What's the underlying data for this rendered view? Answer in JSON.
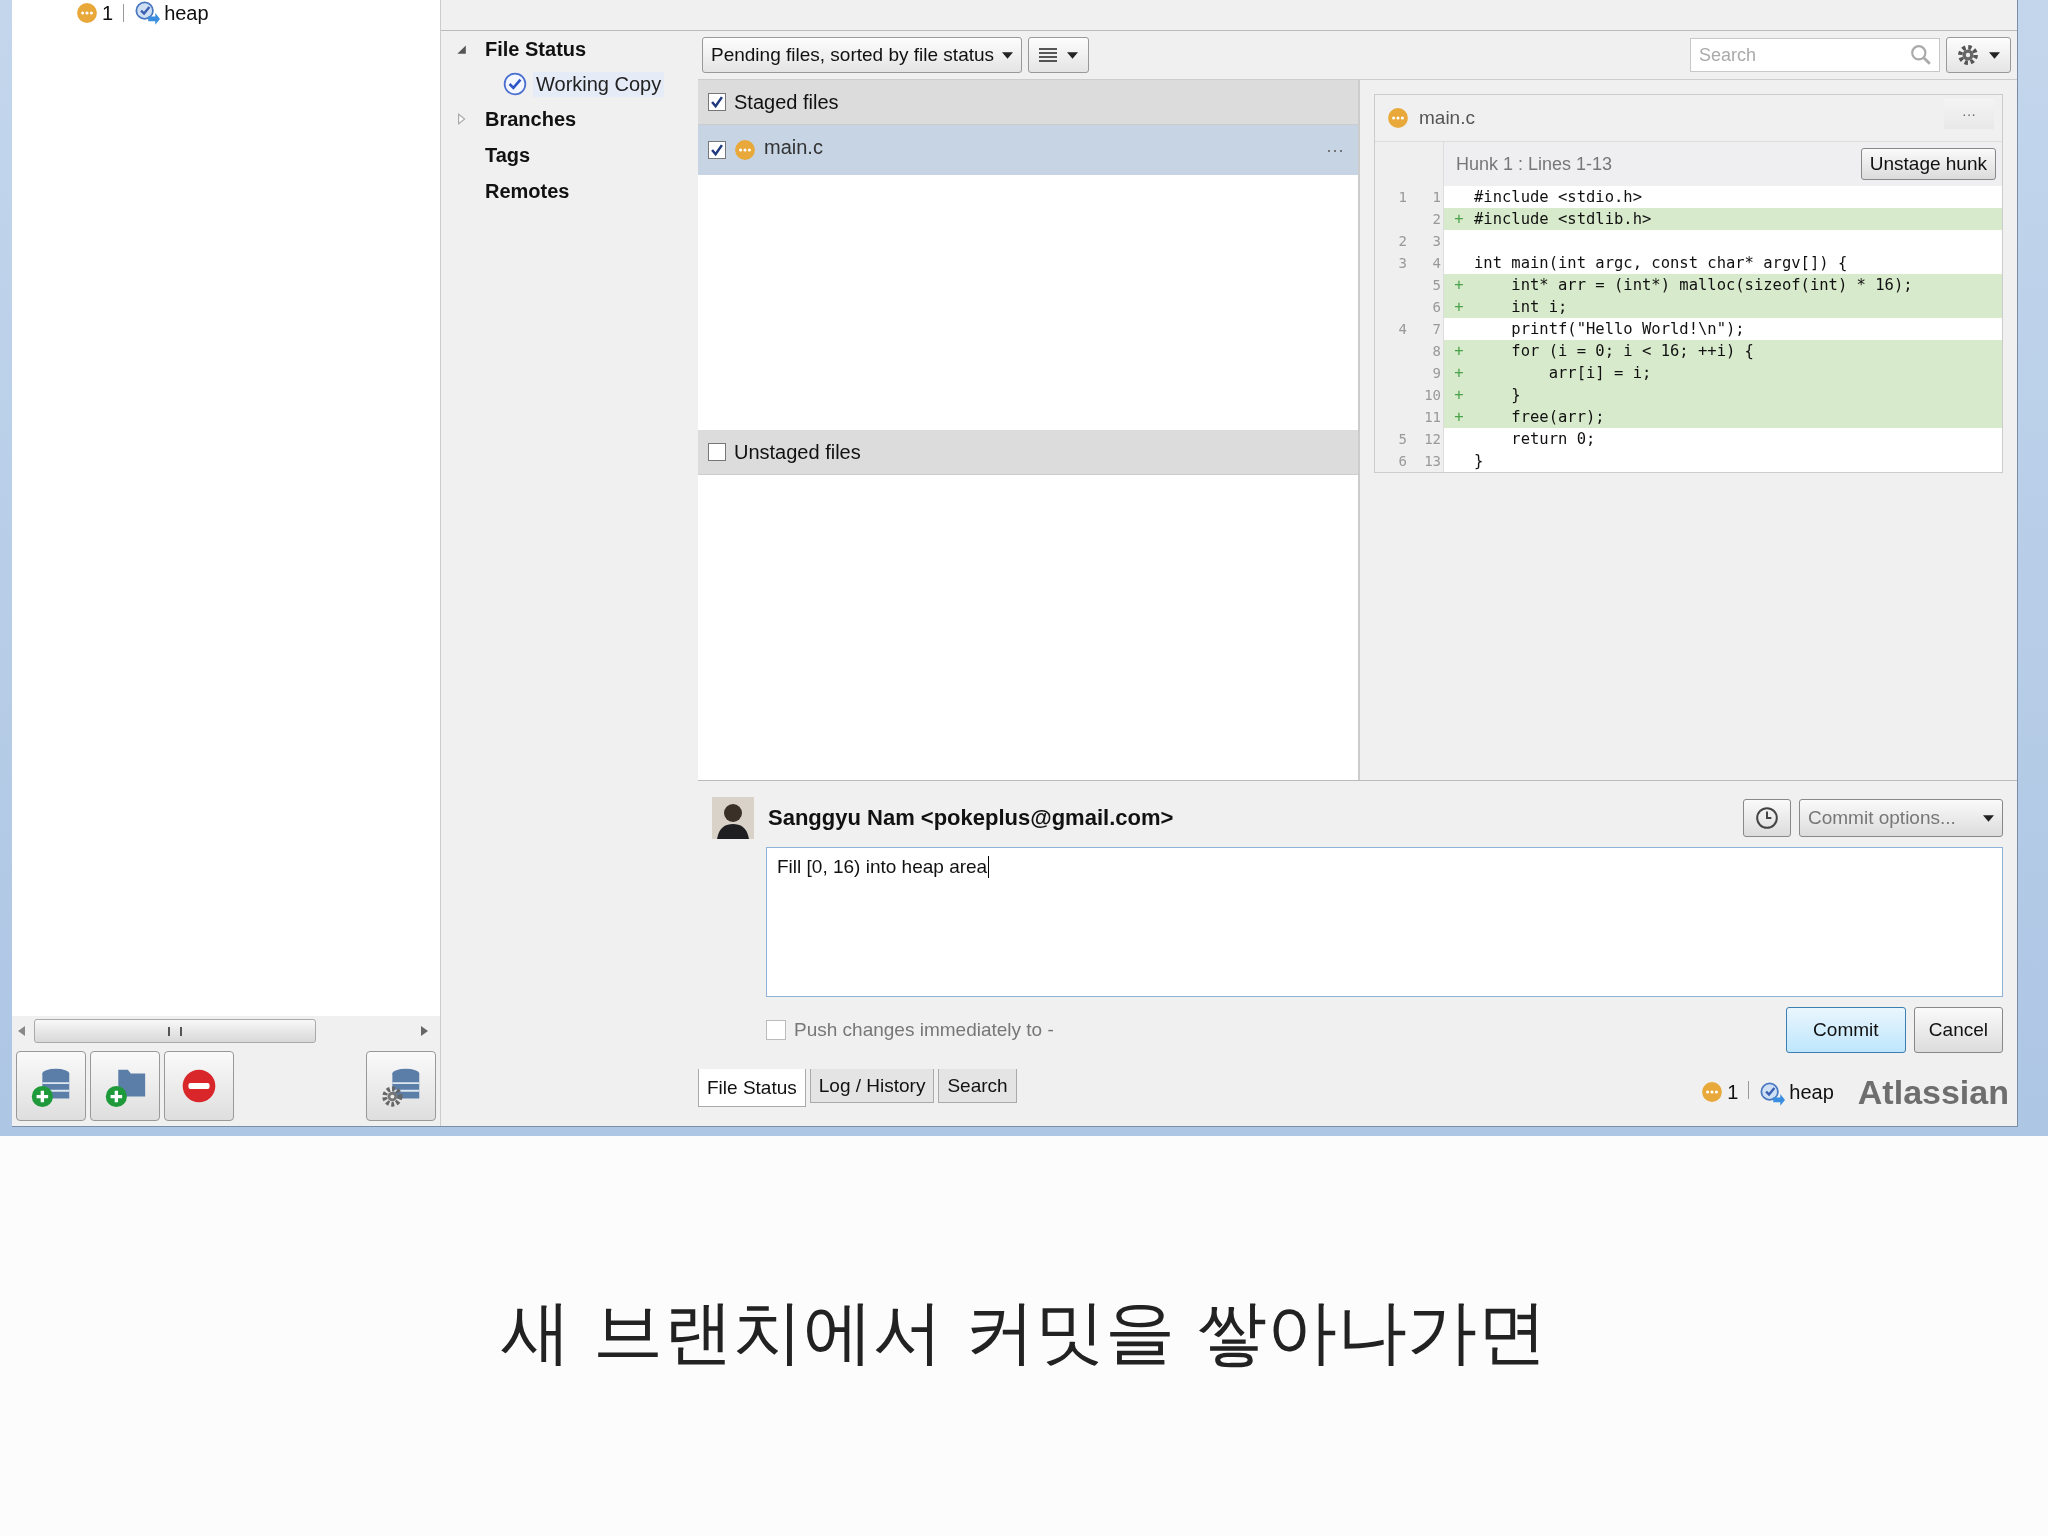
{
  "repo_status": {
    "count": "1",
    "branch": "heap"
  },
  "sidebar": {
    "items": [
      {
        "label": "File Status",
        "expanded": true,
        "children": [
          {
            "label": "Working Copy",
            "selected": true
          }
        ]
      },
      {
        "label": "Branches",
        "expanded": false
      },
      {
        "label": "Tags"
      },
      {
        "label": "Remotes"
      }
    ]
  },
  "toolbar": {
    "sort_dropdown": "Pending files, sorted by file status",
    "search": {
      "placeholder": "Search"
    }
  },
  "staged": {
    "header": "Staged files",
    "checked": true,
    "files": [
      {
        "name": "main.c",
        "checked": true,
        "selected": true,
        "more": "···"
      }
    ]
  },
  "unstaged": {
    "header": "Unstaged files",
    "checked": false
  },
  "diff": {
    "file": "main.c",
    "more": "···",
    "hunk": "Hunk 1 : Lines 1-13",
    "button": "Unstage hunk",
    "lines": [
      {
        "old": "1",
        "new": "1",
        "kind": "context",
        "code": "#include <stdio.h>"
      },
      {
        "new": "2",
        "kind": "added",
        "marker": "+",
        "code": "#include <stdlib.h>"
      },
      {
        "old": "2",
        "new": "3",
        "kind": "context"
      },
      {
        "old": "3",
        "new": "4",
        "kind": "context",
        "code": "int main(int argc, const char* argv[]) {"
      },
      {
        "new": "5",
        "kind": "added",
        "marker": "+",
        "code": "    int* arr = (int*) malloc(sizeof(int) * 16);"
      },
      {
        "new": "6",
        "kind": "added",
        "marker": "+",
        "code": "    int i;"
      },
      {
        "old": "4",
        "new": "7",
        "kind": "context",
        "code": "    printf(\"Hello World!\\n\");"
      },
      {
        "new": "8",
        "kind": "added",
        "marker": "+",
        "code": "    for (i = 0; i < 16; ++i) {"
      },
      {
        "new": "9",
        "kind": "added",
        "marker": "+",
        "code": "        arr[i] = i;"
      },
      {
        "new": "10",
        "kind": "added",
        "marker": "+",
        "code": "    }"
      },
      {
        "new": "11",
        "kind": "added",
        "marker": "+",
        "code": "    free(arr);"
      },
      {
        "old": "5",
        "new": "12",
        "kind": "context",
        "code": "    return 0;"
      },
      {
        "old": "6",
        "new": "13",
        "kind": "context",
        "code": "}"
      }
    ]
  },
  "commit": {
    "author": "Sanggyu Nam <pokeplus@gmail.com>",
    "options": "Commit options...",
    "message": "Fill [0, 16) into heap area",
    "push": {
      "label": "Push changes immediately to -",
      "checked": false
    },
    "buttons": [
      {
        "label": "Commit",
        "kind": "default"
      },
      {
        "label": "Cancel",
        "kind": "normal"
      }
    ]
  },
  "bottom_tabs": [
    {
      "label": "File Status",
      "selected": true
    },
    {
      "label": "Log / History",
      "selected": false
    },
    {
      "label": "Search",
      "selected": false
    }
  ],
  "status_bar": {
    "count": "1",
    "branch": "heap",
    "brand": "Atlassian"
  },
  "subtitle": "새 브랜치에서 커밋을 쌓아나가면"
}
